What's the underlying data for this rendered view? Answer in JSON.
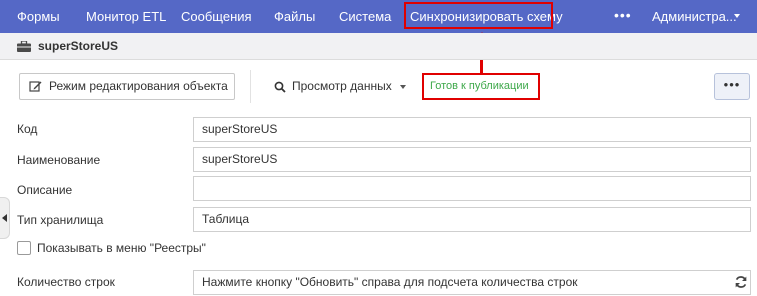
{
  "topnav": {
    "items": [
      {
        "label": "Формы"
      },
      {
        "label": "Монитор ETL"
      },
      {
        "label": "Сообщения"
      },
      {
        "label": "Файлы"
      },
      {
        "label": "Система"
      },
      {
        "label": "Синхронизировать схему"
      }
    ],
    "more_label": "•••",
    "user_label": "Администра...",
    "background_color": "#5568c6",
    "highlight_color": "#e00000"
  },
  "object": {
    "icon": "briefcase-icon",
    "title": "superStoreUS"
  },
  "toolbar": {
    "edit_button_label": "Режим редактирования объекта",
    "edit_icon": "edit-icon",
    "view_data_label": "Просмотр данных",
    "view_data_icon": "search-icon",
    "status_label": "Готов к публикации",
    "status_color": "#3ea84a",
    "more_label": "•••"
  },
  "form": {
    "code": {
      "label": "Код",
      "value": "superStoreUS"
    },
    "name": {
      "label": "Наименование",
      "value": "superStoreUS"
    },
    "description": {
      "label": "Описание",
      "value": ""
    },
    "storage_type": {
      "label": "Тип хранилища",
      "value": "Таблица"
    },
    "show_in_registry": {
      "label": "Показывать в меню \"Реестры\"",
      "checked": false
    },
    "row_count": {
      "label": "Количество строк",
      "value": "Нажмите кнопку \"Обновить\" справа для подсчета количества строк",
      "refresh_icon": "refresh-icon"
    }
  }
}
